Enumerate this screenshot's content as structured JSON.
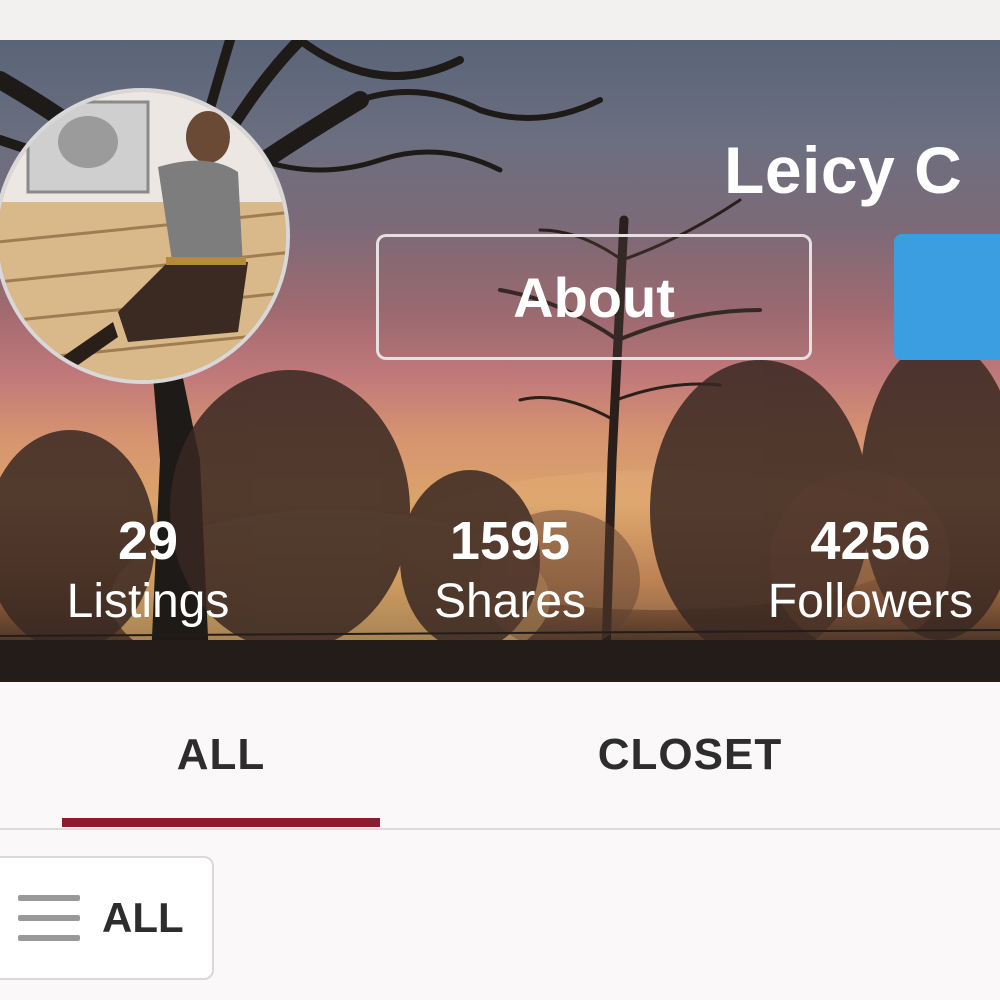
{
  "profile": {
    "name": "Leicy C",
    "about_label": "About"
  },
  "stats": {
    "listings": {
      "value": "29",
      "label": "Listings"
    },
    "shares": {
      "value": "1595",
      "label": "Shares"
    },
    "followers": {
      "value": "4256",
      "label": "Followers"
    }
  },
  "tabs": [
    {
      "label": "ALL",
      "selected": true
    },
    {
      "label": "CLOSET",
      "selected": false
    }
  ],
  "filter": {
    "label": "ALL",
    "icon": "menu-icon"
  },
  "colors": {
    "accent_underline": "#8a1c2e",
    "action_button": "#3a9ee0",
    "text_dark": "#2d2d2d"
  }
}
